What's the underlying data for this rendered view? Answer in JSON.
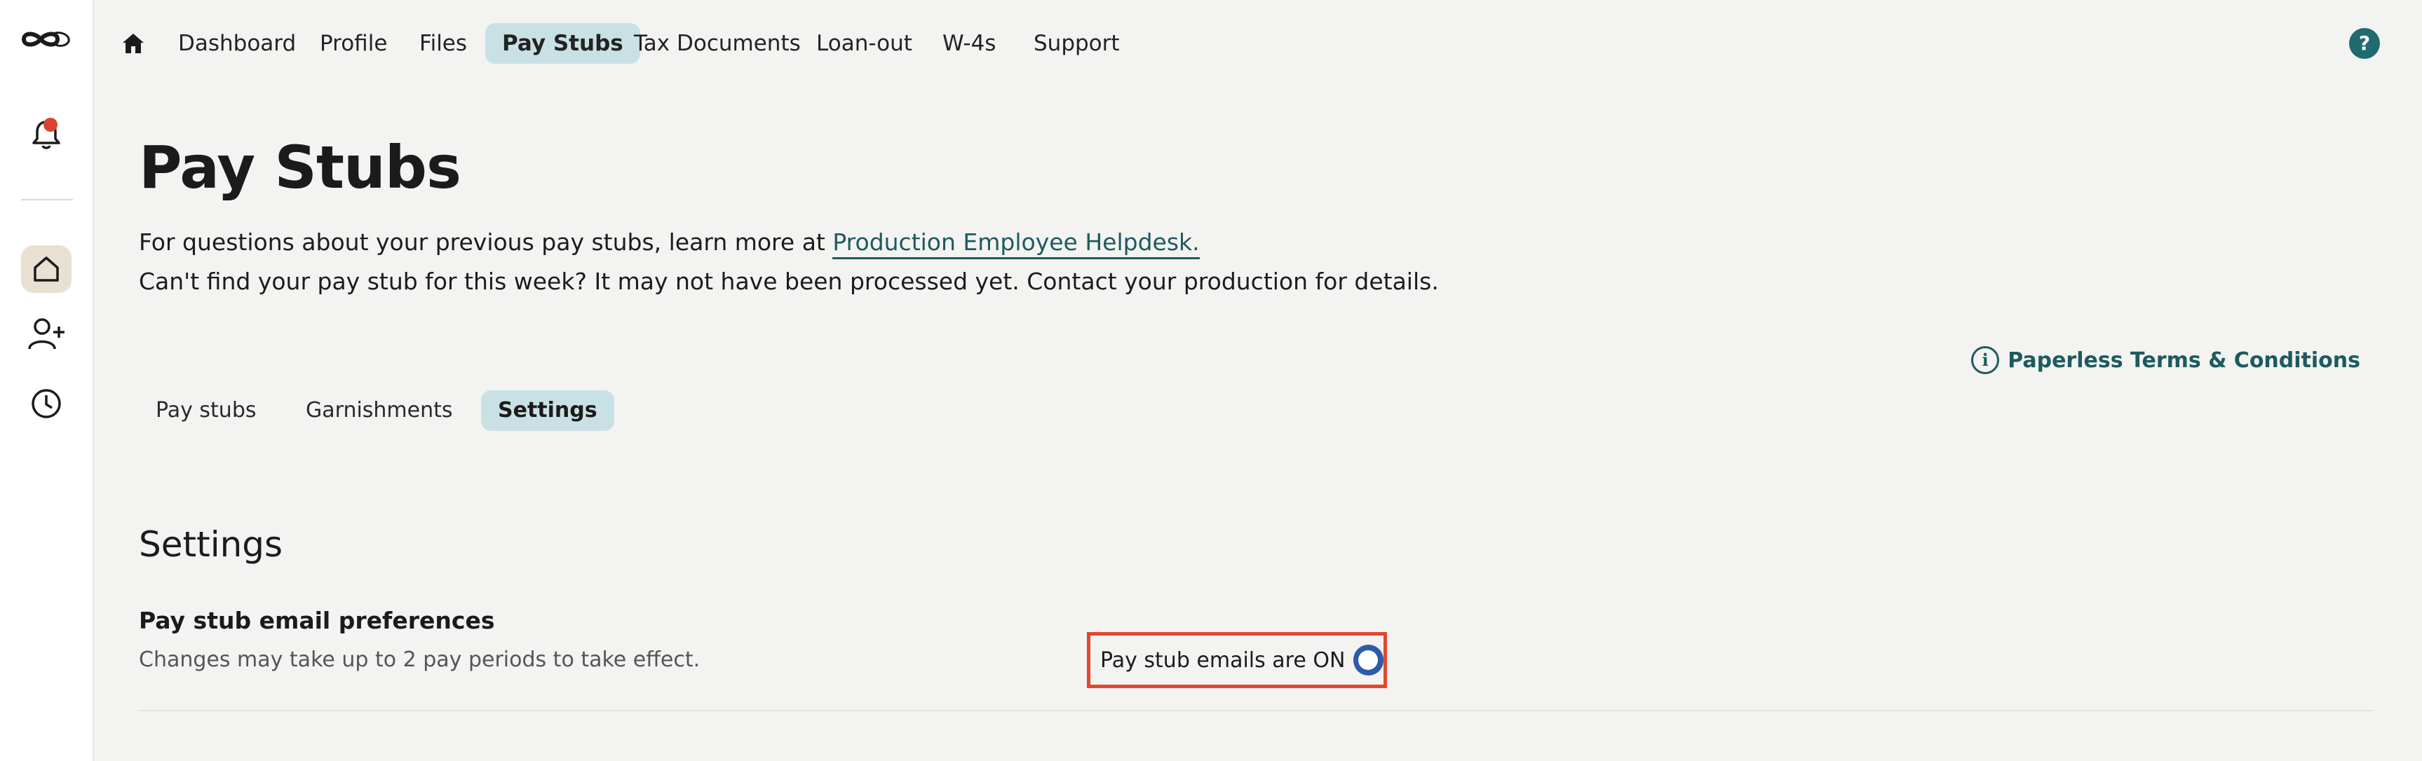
{
  "nav": {
    "items": [
      {
        "label": "Dashboard"
      },
      {
        "label": "Profile"
      },
      {
        "label": "Files"
      },
      {
        "label": "Pay Stubs",
        "active": true
      },
      {
        "label": "Tax Documents"
      },
      {
        "label": "Loan-out"
      },
      {
        "label": "W-4s"
      },
      {
        "label": "Support"
      }
    ],
    "help_label": "?"
  },
  "page": {
    "title": "Pay Stubs",
    "desc1_prefix": "For questions about your previous pay stubs, learn more at ",
    "desc1_link": "Production Employee Helpdesk.",
    "desc2": "Can't find your pay stub for this week? It may not have been processed yet. Contact your production for details.",
    "paperless_label": "Paperless Terms & Conditions",
    "info_glyph": "i"
  },
  "subtabs": [
    {
      "label": "Pay stubs"
    },
    {
      "label": "Garnishments"
    },
    {
      "label": "Settings",
      "active": true
    }
  ],
  "settings": {
    "section_title": "Settings",
    "pref_title": "Pay stub email preferences",
    "pref_desc": "Changes may take up to 2 pay periods to take effect.",
    "toggle_label": "Pay stub emails are ON",
    "toggle_on": true
  },
  "colors": {
    "accent_teal": "#1d5a5e",
    "active_tab_bg": "#c9e1e5",
    "switch_on": "#2f5aa8",
    "highlight_border": "#e2472f",
    "notification_dot": "#d64531"
  },
  "icons": [
    "logo-icon",
    "bell-icon",
    "home-icon",
    "add-user-icon",
    "clock-icon",
    "help-icon",
    "info-icon"
  ]
}
